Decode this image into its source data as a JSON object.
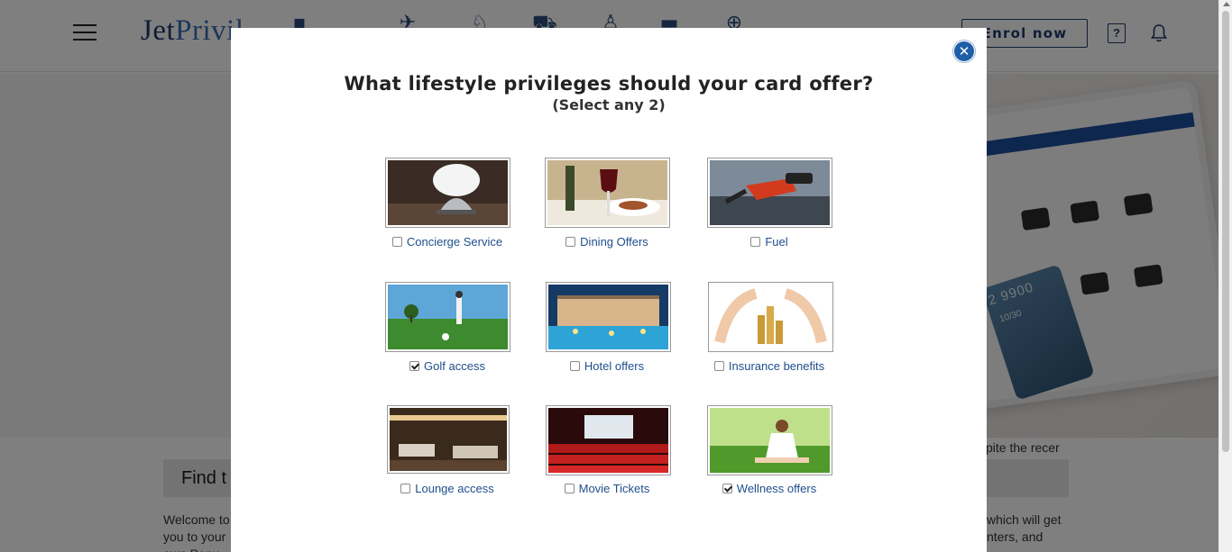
{
  "header": {
    "logo_main": "Jet",
    "logo_accent": "Privil",
    "enrol_label": "Enrol now",
    "help_glyph": "?",
    "nav_icons": [
      "shop-icon",
      "flight-icon",
      "hotel-bell-icon",
      "cart-icon",
      "drink-icon",
      "card-icon",
      "plus-circle-icon"
    ]
  },
  "hero": {
    "card_number": "2 9900",
    "card_expiry": "10/30",
    "ticker_text": "pite the recer"
  },
  "find": {
    "title": "Find t"
  },
  "welcome": {
    "left_text": "Welcome to you to your own Popu",
    "right_text": "which will get nters, and"
  },
  "modal": {
    "title": "What lifestyle privileges should your card offer?",
    "subtitle": "(Select any 2)",
    "close_glyph": "✕",
    "options": [
      {
        "label": "Concierge Service",
        "checked": false,
        "image": "concierge-bell"
      },
      {
        "label": "Dining Offers",
        "checked": false,
        "image": "dining"
      },
      {
        "label": "Fuel",
        "checked": false,
        "image": "fuel-nozzle"
      },
      {
        "label": "Golf access",
        "checked": true,
        "image": "golf"
      },
      {
        "label": "Hotel offers",
        "checked": false,
        "image": "hotel"
      },
      {
        "label": "Insurance benefits",
        "checked": false,
        "image": "insurance-hands-coins"
      },
      {
        "label": "Lounge access",
        "checked": false,
        "image": "lounge"
      },
      {
        "label": "Movie Tickets",
        "checked": false,
        "image": "cinema"
      },
      {
        "label": "Wellness offers",
        "checked": true,
        "image": "yoga"
      }
    ]
  },
  "colors": {
    "brand": "#1f3b6b",
    "link": "#1f4e8c",
    "close": "#1f5fa8"
  }
}
